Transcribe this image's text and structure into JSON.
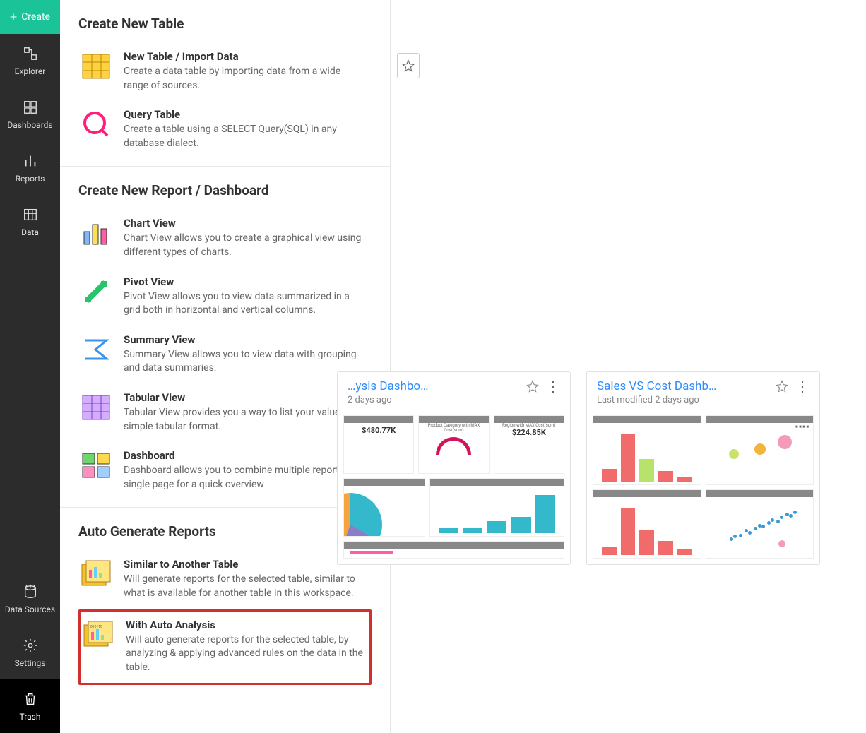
{
  "create_button": {
    "label": "Create"
  },
  "sidebar": {
    "items": [
      {
        "label": "Explorer"
      },
      {
        "label": "Dashboards"
      },
      {
        "label": "Reports"
      },
      {
        "label": "Data"
      }
    ],
    "bottom_items": [
      {
        "label": "Data Sources"
      },
      {
        "label": "Settings"
      },
      {
        "label": "Trash"
      }
    ]
  },
  "panel": {
    "sections": [
      {
        "title": "Create New Table",
        "options": [
          {
            "title": "New Table / Import Data",
            "desc": "Create a data table by importing data from a wide range of sources."
          },
          {
            "title": "Query Table",
            "desc": "Create a table using a SELECT Query(SQL) in any database dialect."
          }
        ]
      },
      {
        "title": "Create New Report / Dashboard",
        "options": [
          {
            "title": "Chart View",
            "desc": "Chart View allows you to create a graphical view using different types of charts."
          },
          {
            "title": "Pivot View",
            "desc": "Pivot View allows you to view data summarized in a grid both in horizontal and vertical columns."
          },
          {
            "title": "Summary View",
            "desc": "Summary View allows you to view data with grouping and data summaries."
          },
          {
            "title": "Tabular View",
            "desc": "Tabular View provides you a way to list your values in a simple tabular format."
          },
          {
            "title": "Dashboard",
            "desc": "Dashboard allows you to combine multiple reports in a single page for a quick overview"
          }
        ]
      },
      {
        "title": "Auto Generate Reports",
        "options": [
          {
            "title": "Similar to Another Table",
            "desc": "Will generate reports for the selected table, similar to what is available for another table in this workspace."
          },
          {
            "title": "With Auto Analysis",
            "desc": "Will auto generate reports for the selected table, by analyzing & applying advanced rules on the data in the table."
          }
        ]
      }
    ]
  },
  "cards": [
    {
      "title": "…ysis Dashbo…",
      "meta": "2 days ago",
      "stat1": "$480.77K",
      "stat2": "$224.85K",
      "stat1_label": "Product Category with MAX Cost(sum)",
      "stat2_label": "Region with MAX Cost(sum)"
    },
    {
      "title": "Sales VS Cost Dashb…",
      "meta": "Last modified 2 days ago"
    }
  ],
  "colors": {
    "accent": "#1bc498",
    "link": "#2d8cff"
  }
}
